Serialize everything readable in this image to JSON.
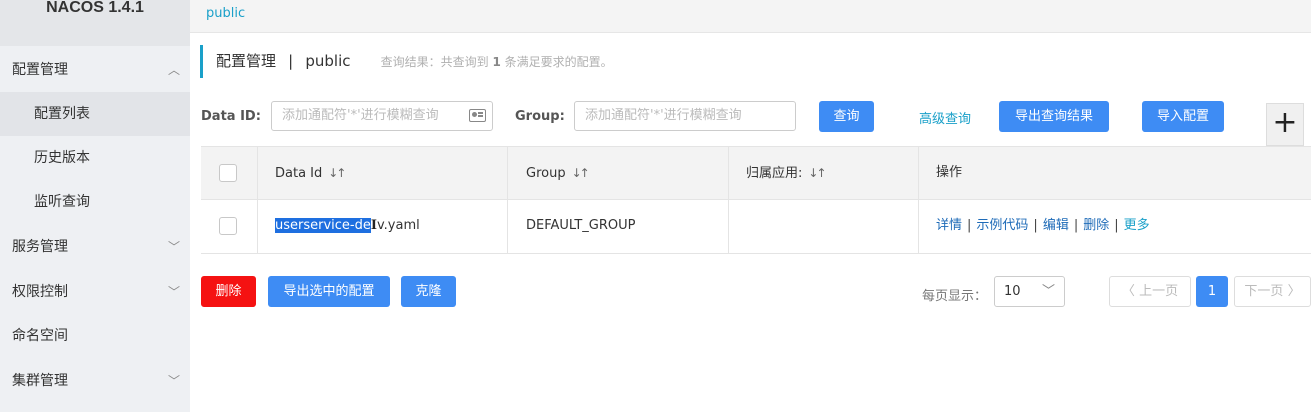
{
  "app": {
    "title": "NACOS 1.4.1"
  },
  "sidebar": {
    "items": [
      {
        "label": "配置管理",
        "expanded": true
      },
      {
        "label": "配置列表",
        "active": true
      },
      {
        "label": "历史版本"
      },
      {
        "label": "监听查询"
      },
      {
        "label": "服务管理"
      },
      {
        "label": "权限控制"
      },
      {
        "label": "命名空间"
      },
      {
        "label": "集群管理"
      }
    ]
  },
  "tabbar": {
    "namespace_tab": "public"
  },
  "heading": {
    "title": "配置管理",
    "separator": "|",
    "namespace": "public",
    "result_prefix": "查询结果：共查询到",
    "result_count": "1",
    "result_suffix": "条满足要求的配置。"
  },
  "filters": {
    "data_id_label": "Data ID:",
    "data_id_placeholder": "添加通配符'*'进行模糊查询",
    "group_label": "Group:",
    "group_placeholder": "添加通配符'*'进行模糊查询",
    "search_button": "查询",
    "advanced_link": "高级查询",
    "export_results_button": "导出查询结果",
    "import_button": "导入配置",
    "add_button": "+"
  },
  "table": {
    "headers": {
      "data_id": "Data Id",
      "group": "Group",
      "app": "归属应用:",
      "ops": "操作"
    },
    "rows": [
      {
        "data_id_selected": "userservice-de",
        "data_id_rest": "v.yaml",
        "group": "DEFAULT_GROUP",
        "app": "",
        "ops": {
          "detail": "详情",
          "sample": "示例代码",
          "edit": "编辑",
          "delete": "删除",
          "more": "更多"
        }
      }
    ]
  },
  "bulk": {
    "delete": "删除",
    "export_selected": "导出选中的配置",
    "clone": "克隆"
  },
  "pagination": {
    "page_size_label": "每页显示：",
    "page_size": "10",
    "prev": "上一页",
    "current_page": "1",
    "next": "下一页"
  },
  "colors": {
    "accent": "#1aa0c9",
    "primary_button": "#3e8cf4",
    "danger_button": "#f51212",
    "selection": "#1e6fe0"
  }
}
